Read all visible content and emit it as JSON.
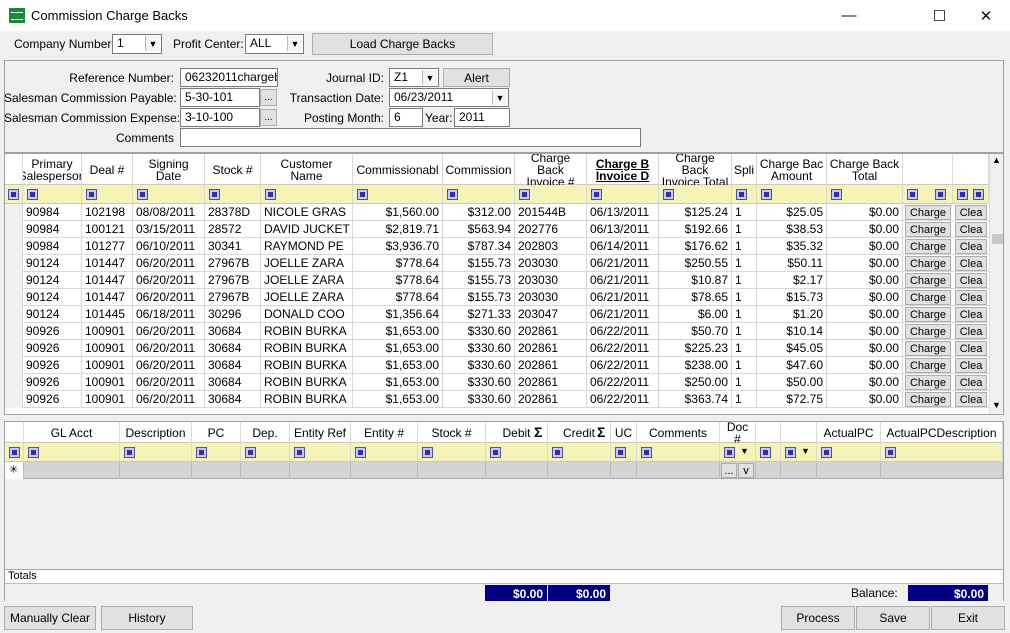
{
  "window": {
    "title": "Commission Charge Backs",
    "minimize": "—",
    "maximize": "☐",
    "close": "✕"
  },
  "toolbar": {
    "company_label": "Company Number:",
    "company_value": "1",
    "profit_label": "Profit Center:",
    "profit_value": "ALL",
    "load_button": "Load Charge Backs"
  },
  "form": {
    "ref_label": "Reference Number:",
    "ref_value": "06232011chargeb",
    "payable_label": "Salesman Commission Payable:",
    "payable_value": "5-30-101",
    "expense_label": "Salesman Commission Expense:",
    "expense_value": "3-10-100",
    "comments_label": "Comments",
    "comments_value": "",
    "journal_label": "Journal ID:",
    "journal_value": "Z1",
    "alert_button": "Alert",
    "trans_label": "Transaction Date:",
    "trans_value": "06/23/2011",
    "month_label": "Posting Month:",
    "month_value": "6",
    "year_label": "Year:",
    "year_value": "2011",
    "ellipsis": "..."
  },
  "grid": {
    "headers": [
      "Primary Salesperson",
      "Deal #",
      "Signing Date",
      "Stock #",
      "Customer Name",
      "Commissionabl",
      "Commission",
      "Charge Back Invoice #",
      "Charge B Invoice D",
      "Charge Back Invoice Total",
      "Spli",
      "Charge Bac Amount",
      "Charge Back Total",
      "",
      ""
    ],
    "charge_label": "Charge",
    "clear_label": "Clea",
    "rows": [
      [
        "90984",
        "102198",
        "08/08/2011",
        "28378D",
        "NICOLE GRAS",
        "$1,560.00",
        "$312.00",
        "201544B",
        "06/13/2011",
        "$125.24",
        "1",
        "$25.05",
        "$0.00"
      ],
      [
        "90984",
        "100121",
        "03/15/2011",
        "28572",
        "DAVID JUCKET",
        "$2,819.71",
        "$563.94",
        "202776",
        "06/13/2011",
        "$192.66",
        "1",
        "$38.53",
        "$0.00"
      ],
      [
        "90984",
        "101277",
        "06/10/2011",
        "30341",
        "RAYMOND PE",
        "$3,936.70",
        "$787.34",
        "202803",
        "06/14/2011",
        "$176.62",
        "1",
        "$35.32",
        "$0.00"
      ],
      [
        "90124",
        "101447",
        "06/20/2011",
        "27967B",
        "JOELLE ZARA",
        "$778.64",
        "$155.73",
        "203030",
        "06/21/2011",
        "$250.55",
        "1",
        "$50.11",
        "$0.00"
      ],
      [
        "90124",
        "101447",
        "06/20/2011",
        "27967B",
        "JOELLE ZARA",
        "$778.64",
        "$155.73",
        "203030",
        "06/21/2011",
        "$10.87",
        "1",
        "$2.17",
        "$0.00"
      ],
      [
        "90124",
        "101447",
        "06/20/2011",
        "27967B",
        "JOELLE ZARA",
        "$778.64",
        "$155.73",
        "203030",
        "06/21/2011",
        "$78.65",
        "1",
        "$15.73",
        "$0.00"
      ],
      [
        "90124",
        "101445",
        "06/18/2011",
        "30296",
        "DONALD COO",
        "$1,356.64",
        "$271.33",
        "203047",
        "06/21/2011",
        "$6.00",
        "1",
        "$1.20",
        "$0.00"
      ],
      [
        "90926",
        "100901",
        "06/20/2011",
        "30684",
        "ROBIN BURKA",
        "$1,653.00",
        "$330.60",
        "202861",
        "06/22/2011",
        "$50.70",
        "1",
        "$10.14",
        "$0.00"
      ],
      [
        "90926",
        "100901",
        "06/20/2011",
        "30684",
        "ROBIN BURKA",
        "$1,653.00",
        "$330.60",
        "202861",
        "06/22/2011",
        "$225.23",
        "1",
        "$45.05",
        "$0.00"
      ],
      [
        "90926",
        "100901",
        "06/20/2011",
        "30684",
        "ROBIN BURKA",
        "$1,653.00",
        "$330.60",
        "202861",
        "06/22/2011",
        "$238.00",
        "1",
        "$47.60",
        "$0.00"
      ],
      [
        "90926",
        "100901",
        "06/20/2011",
        "30684",
        "ROBIN BURKA",
        "$1,653.00",
        "$330.60",
        "202861",
        "06/22/2011",
        "$250.00",
        "1",
        "$50.00",
        "$0.00"
      ],
      [
        "90926",
        "100901",
        "06/20/2011",
        "30684",
        "ROBIN BURKA",
        "$1,653.00",
        "$330.60",
        "202861",
        "06/22/2011",
        "$363.74",
        "1",
        "$72.75",
        "$0.00"
      ]
    ]
  },
  "gl": {
    "headers": [
      "GL Acct",
      "Description",
      "PC",
      "Dep.",
      "Entity Ref",
      "Entity #",
      "Stock #",
      "Debit",
      "Credit",
      "UC",
      "Comments",
      "Doc #",
      "",
      "",
      "ActualPC",
      "ActualPCDescription"
    ],
    "sigma": "Σ",
    "new_row": "✳",
    "doc_btn1": "...",
    "doc_btn2": "v",
    "totals_label": "Totals",
    "debit_total": "$0.00",
    "credit_total": "$0.00",
    "balance_label": "Balance:",
    "balance_value": "$0.00"
  },
  "footer": {
    "manual_clear": "Manually Clear",
    "history": "History",
    "process": "Process",
    "save": "Save",
    "exit": "Exit"
  }
}
